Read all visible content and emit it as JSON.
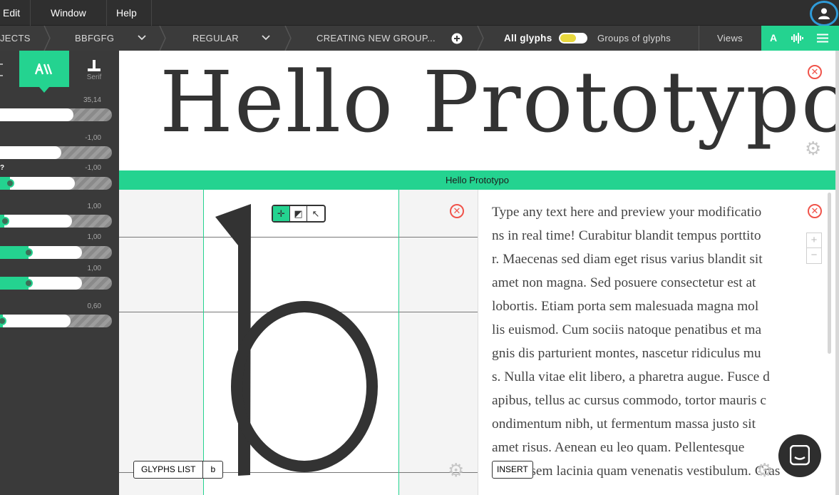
{
  "menu": {
    "items": [
      "Edit",
      "Window",
      "Help"
    ]
  },
  "toolbar": {
    "projects_label": "JECTS",
    "family": "BBFGFG",
    "variant": "REGULAR",
    "group": "CREATING NEW GROUP...",
    "all_glyphs": "All glyphs",
    "groups_of_glyphs": "Groups of glyphs",
    "views": "Views",
    "view_text_icon": "A",
    "toggle_color": "#e8d83d"
  },
  "left_panel": {
    "serif_tab_label": "Serif",
    "sliders": [
      {
        "value_label": "35,14",
        "fill": 0.66
      },
      {
        "value_label": "-1,00",
        "fill": 0.55
      },
      {
        "value_label": "-1,00",
        "fill": 0.67,
        "question": "?"
      },
      {
        "value_label": "1,00",
        "fill": 0.64
      },
      {
        "value_label": "1,00",
        "fill": 0.73
      },
      {
        "value_label": "1,00",
        "fill": 0.73
      },
      {
        "value_label": "0,60",
        "fill": 0.63
      }
    ]
  },
  "preview": {
    "headline": "Hello Prototypo",
    "band_label": "Hello Prototypo"
  },
  "glyph": {
    "char": "b",
    "glyphs_list_label": "GLYPHS LIST",
    "current_glyph": "b"
  },
  "text_panel": {
    "lines": [
      "Type any text here and preview your modificatio",
      "ns in real time! Curabitur blandit tempus porttito",
      "r. Maecenas sed diam eget risus varius blandit sit",
      " amet non magna. Sed posuere consectetur est at",
      " lobortis. Etiam porta sem malesuada magna mol",
      "lis euismod. Cum sociis natoque penatibus et ma",
      "gnis dis parturient montes, nascetur ridiculus mu",
      "s. Nulla vitae elit libero, a pharetra augue. Fusce d",
      "apibus, tellus ac cursus commodo, tortor mauris c",
      "ondimentum nibh, ut fermentum massa justo sit",
      " amet risus. Aenean eu leo quam. Pellentesque",
      "ornare sem lacinia quam venenatis vestibulum. Cras"
    ],
    "insert_label": "INSERT",
    "zoom_in": "+",
    "zoom_out": "−"
  },
  "colors": {
    "accent": "#24d390",
    "close": "#f0534a",
    "account_ring": "#2f9bd8"
  },
  "icons": [
    "account-icon",
    "chevron-down-icon",
    "plus-circle-icon",
    "close-icon",
    "gear-icon",
    "move-tool-icon",
    "shape-tool-icon",
    "pointer-tool-icon",
    "chat-icon"
  ]
}
